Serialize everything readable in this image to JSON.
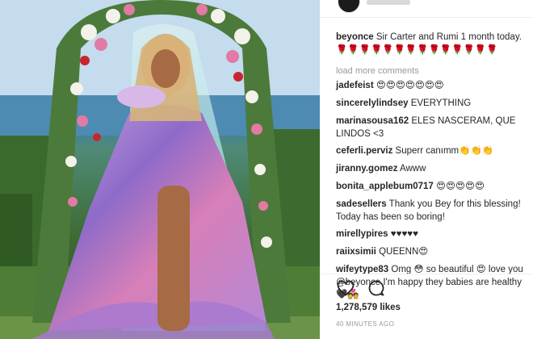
{
  "post": {
    "author": "beyonce",
    "caption": "Sir Carter and Rumi 1 month today. 🌹🌹🌹🌹🌹🌹🌹🌹🌹🌹🌹🌹🌹🌹",
    "load_more": "load more comments",
    "likes": "1,278,579 likes",
    "timestamp": "40 MINUTES AGO"
  },
  "comments": [
    {
      "user": "jadefeist",
      "text": "😍😍😍😍😍😍😍"
    },
    {
      "user": "sincerelylindsey",
      "text": "EVERYTHING"
    },
    {
      "user": "marinasousa162",
      "text": "ELES NASCERAM, QUE LINDOS <3"
    },
    {
      "user": "ceferli.perviz",
      "text": "Superr canımm👏👏👏"
    },
    {
      "user": "jiranny.gomez",
      "text": "Awww"
    },
    {
      "user": "bonita_applebum0717",
      "text": "😍😍😍😍😍"
    },
    {
      "user": "sadesellers",
      "text": "Thank you Bey for this blessing! Today has been so boring!"
    },
    {
      "user": "mirellypires",
      "text": "♥♥♥♥♥"
    },
    {
      "user": "raiixsimii",
      "text": "QUEENN😍"
    },
    {
      "user": "wifeytype83",
      "text": "Omg 😳 so beautiful 😍 love you @beyonce I'm happy they babies are healthy 🖤💑"
    }
  ],
  "icons": {
    "like": "heart-icon",
    "comment": "speech-bubble-icon",
    "avatar": "avatar"
  },
  "colors": {
    "username": "#262626",
    "muted": "#999999",
    "border": "#efefef"
  }
}
